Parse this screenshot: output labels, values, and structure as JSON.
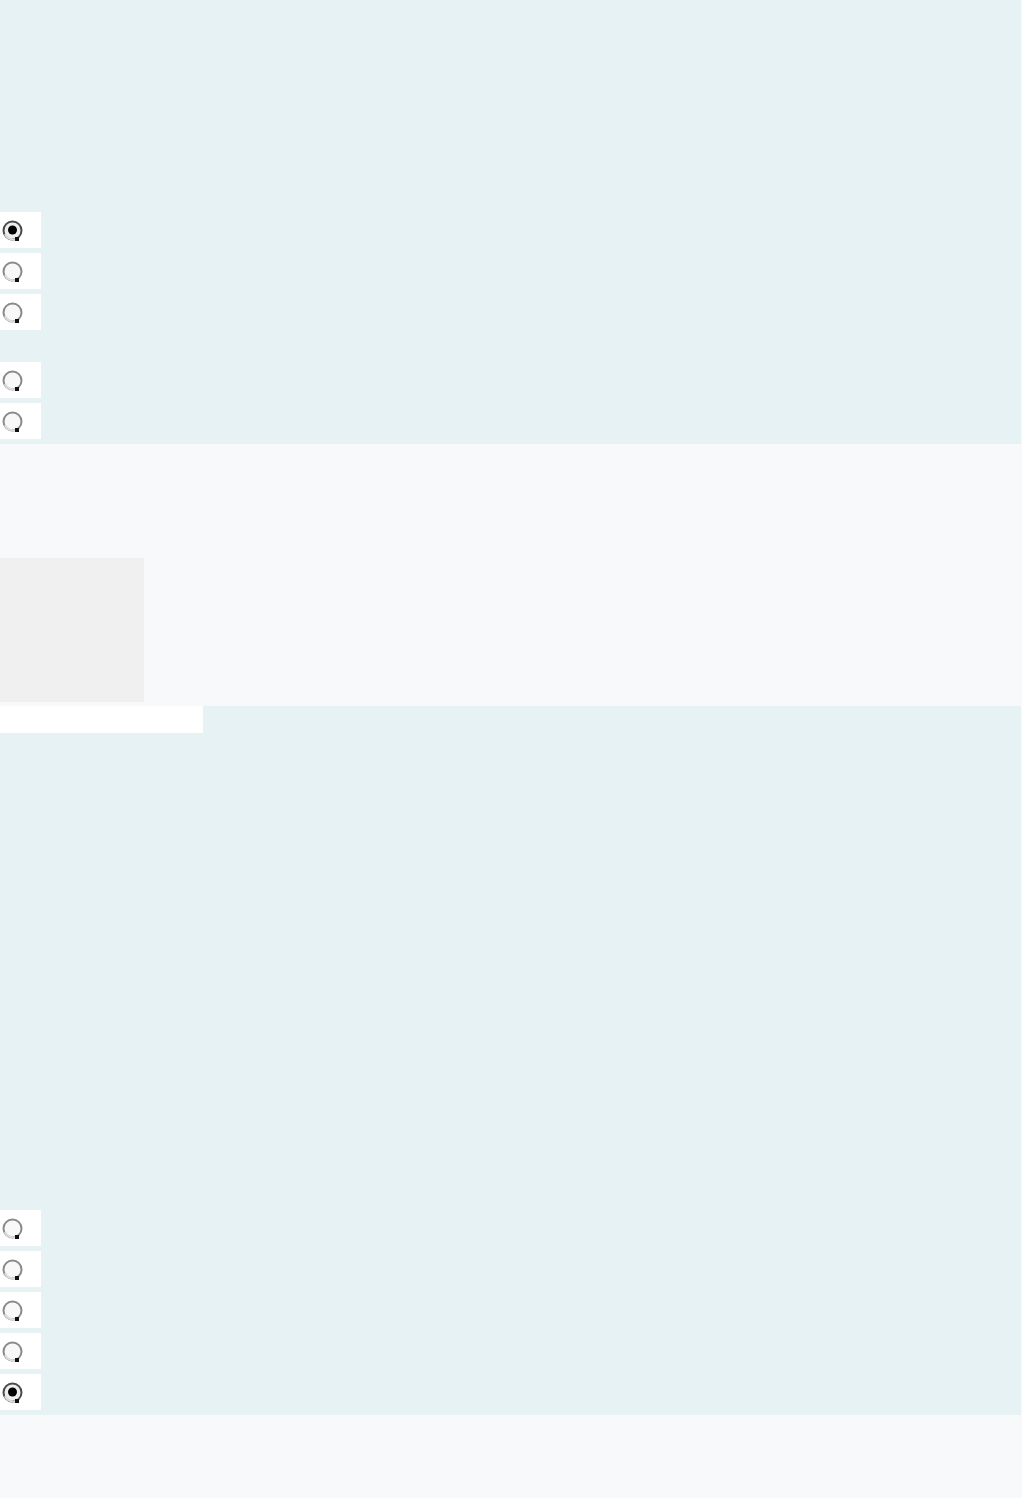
{
  "top_panel": {
    "radio_groups": [
      {
        "options": [
          {
            "selected": true
          },
          {
            "selected": false
          },
          {
            "selected": false
          }
        ]
      },
      {
        "options": [
          {
            "selected": false
          },
          {
            "selected": false
          }
        ]
      }
    ]
  },
  "bottom_panel": {
    "radio_groups": [
      {
        "options": [
          {
            "selected": false
          },
          {
            "selected": false
          },
          {
            "selected": false
          },
          {
            "selected": false
          },
          {
            "selected": true
          }
        ]
      }
    ]
  }
}
